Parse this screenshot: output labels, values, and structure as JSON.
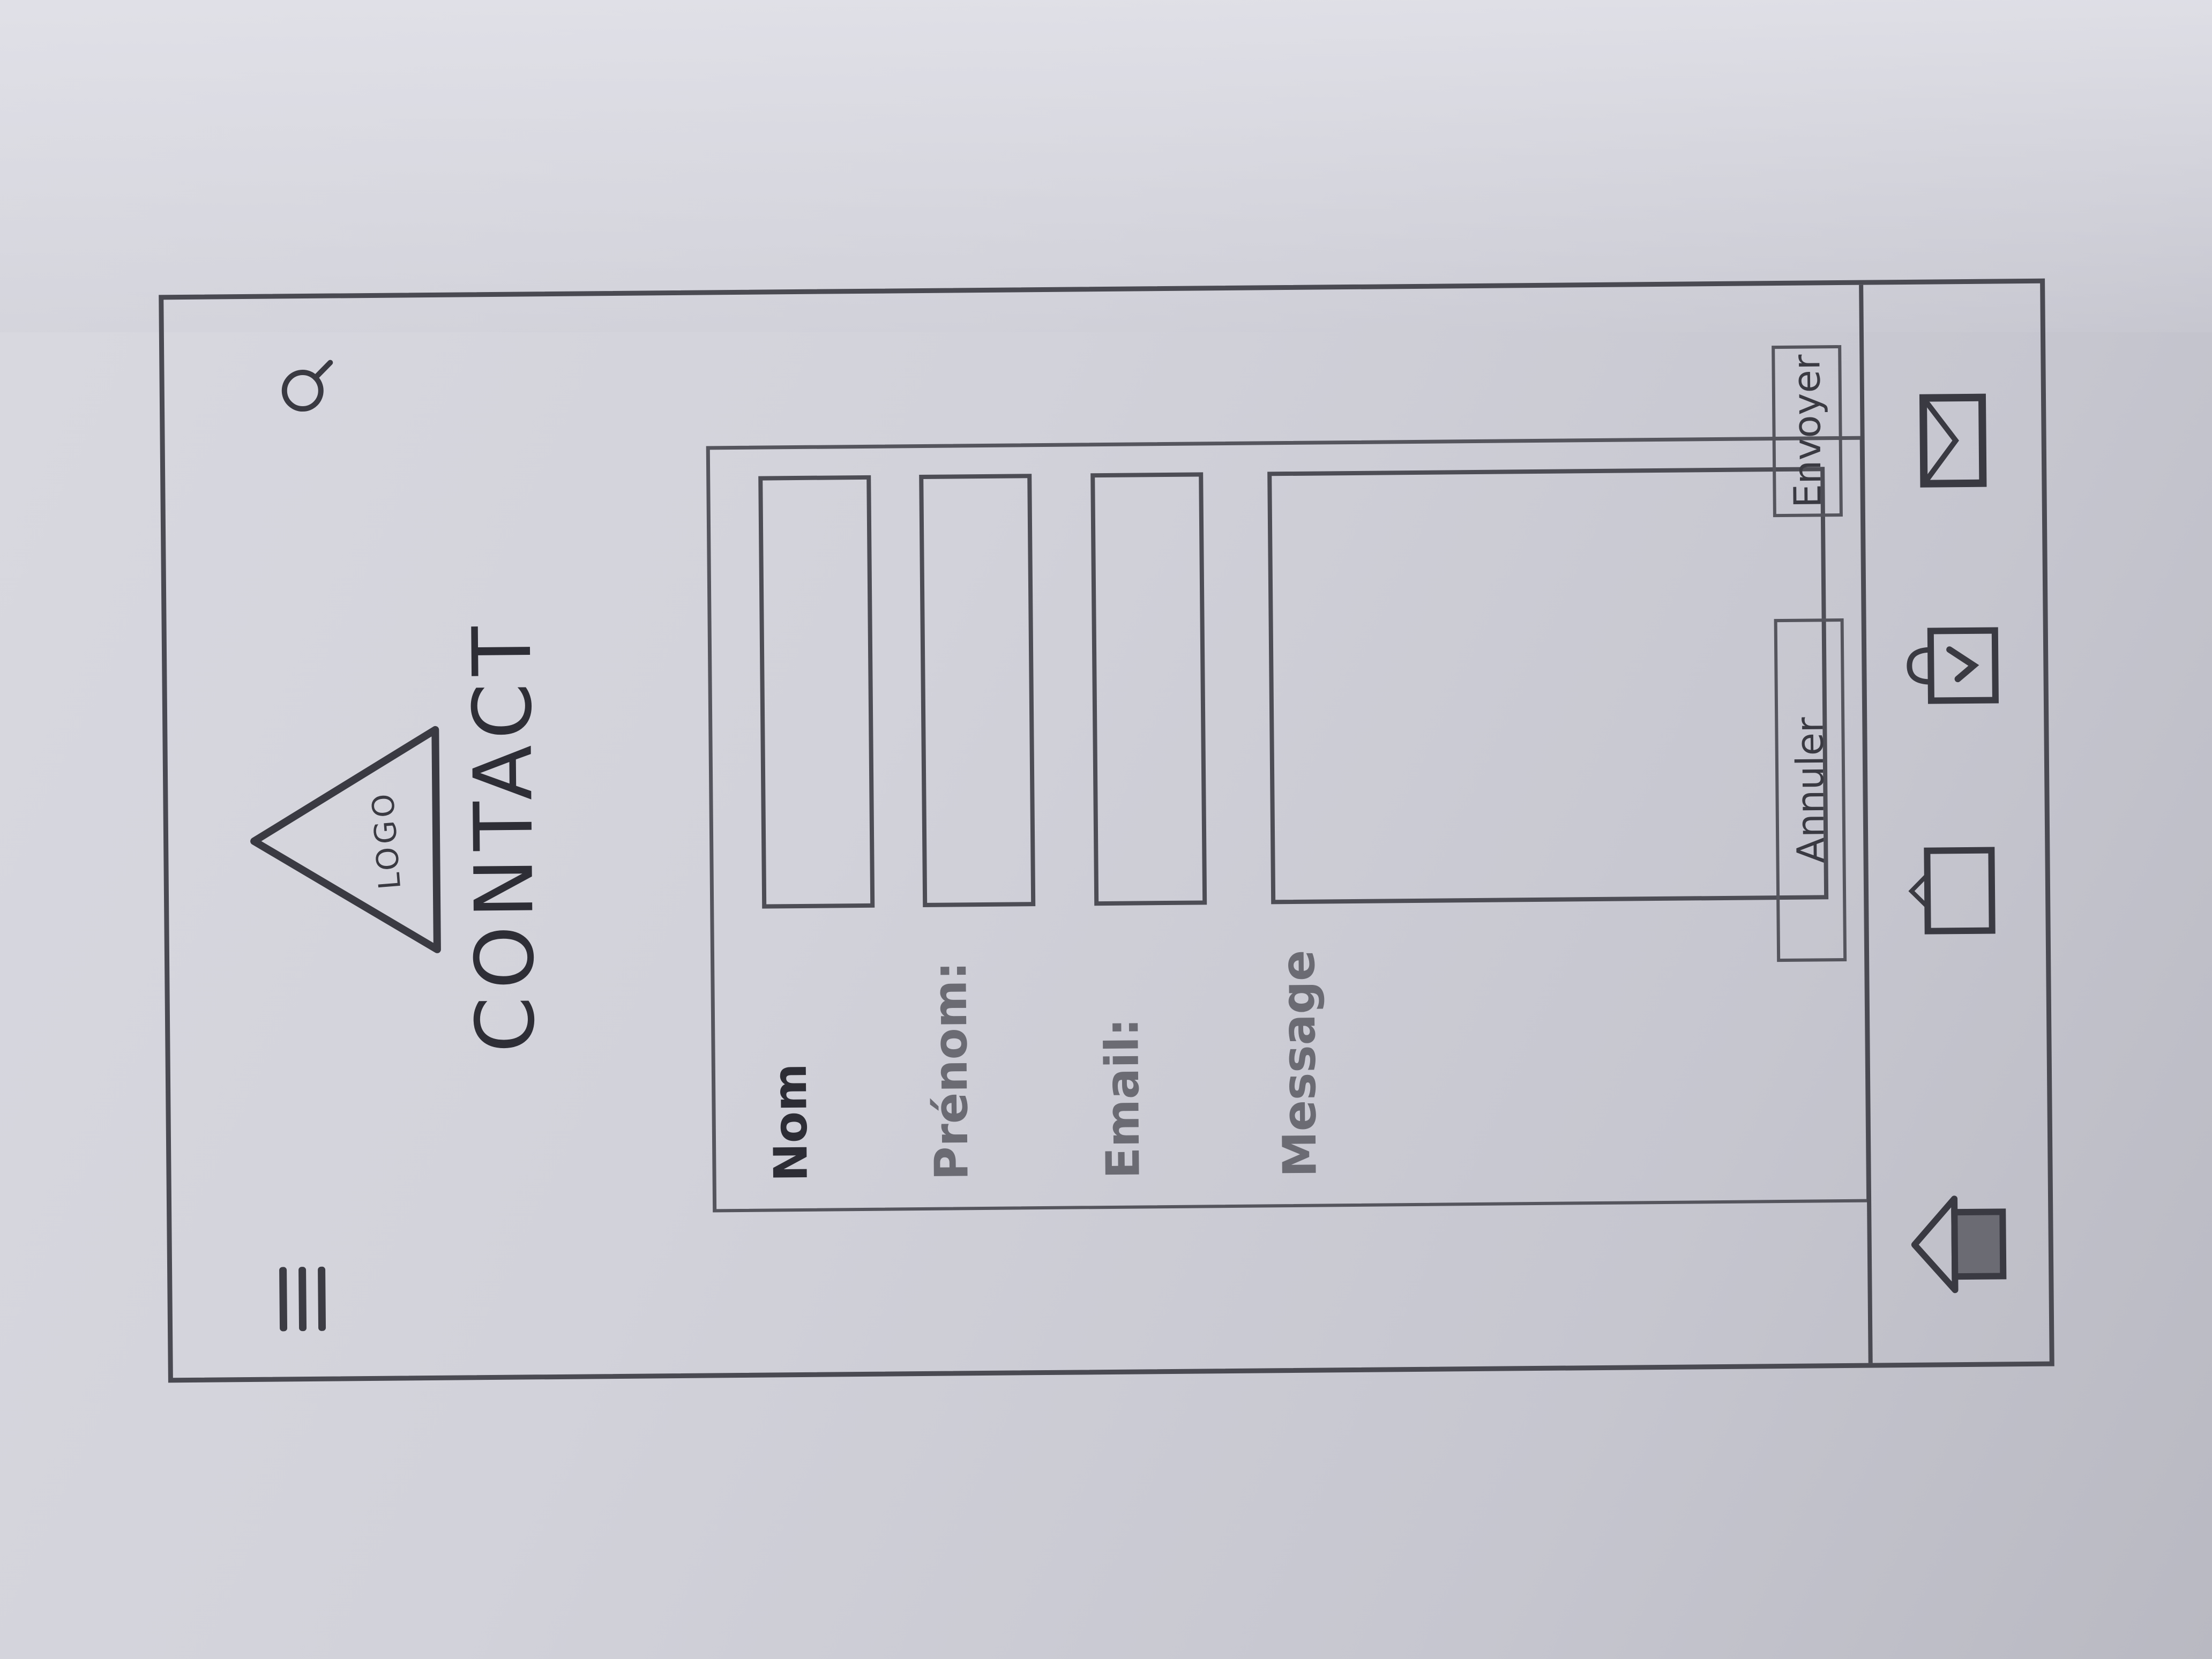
{
  "header": {
    "logo_text": "LOGO",
    "title": "CONTACT"
  },
  "form": {
    "fields": [
      {
        "label": "Nom",
        "value": ""
      },
      {
        "label": "Prénom:",
        "value": ""
      },
      {
        "label": "Email:",
        "value": ""
      },
      {
        "label": "Message",
        "value": ""
      }
    ]
  },
  "actions": {
    "cancel_label": "Annuler",
    "submit_label": "Envoyer"
  },
  "bottom_nav": {
    "items": [
      {
        "icon": "home-icon"
      },
      {
        "icon": "news-icon"
      },
      {
        "icon": "shopping-bag-icon"
      },
      {
        "icon": "mail-icon"
      }
    ]
  },
  "colors": {
    "pencil": "#3a3a42",
    "paper": "#d6d6dd"
  }
}
